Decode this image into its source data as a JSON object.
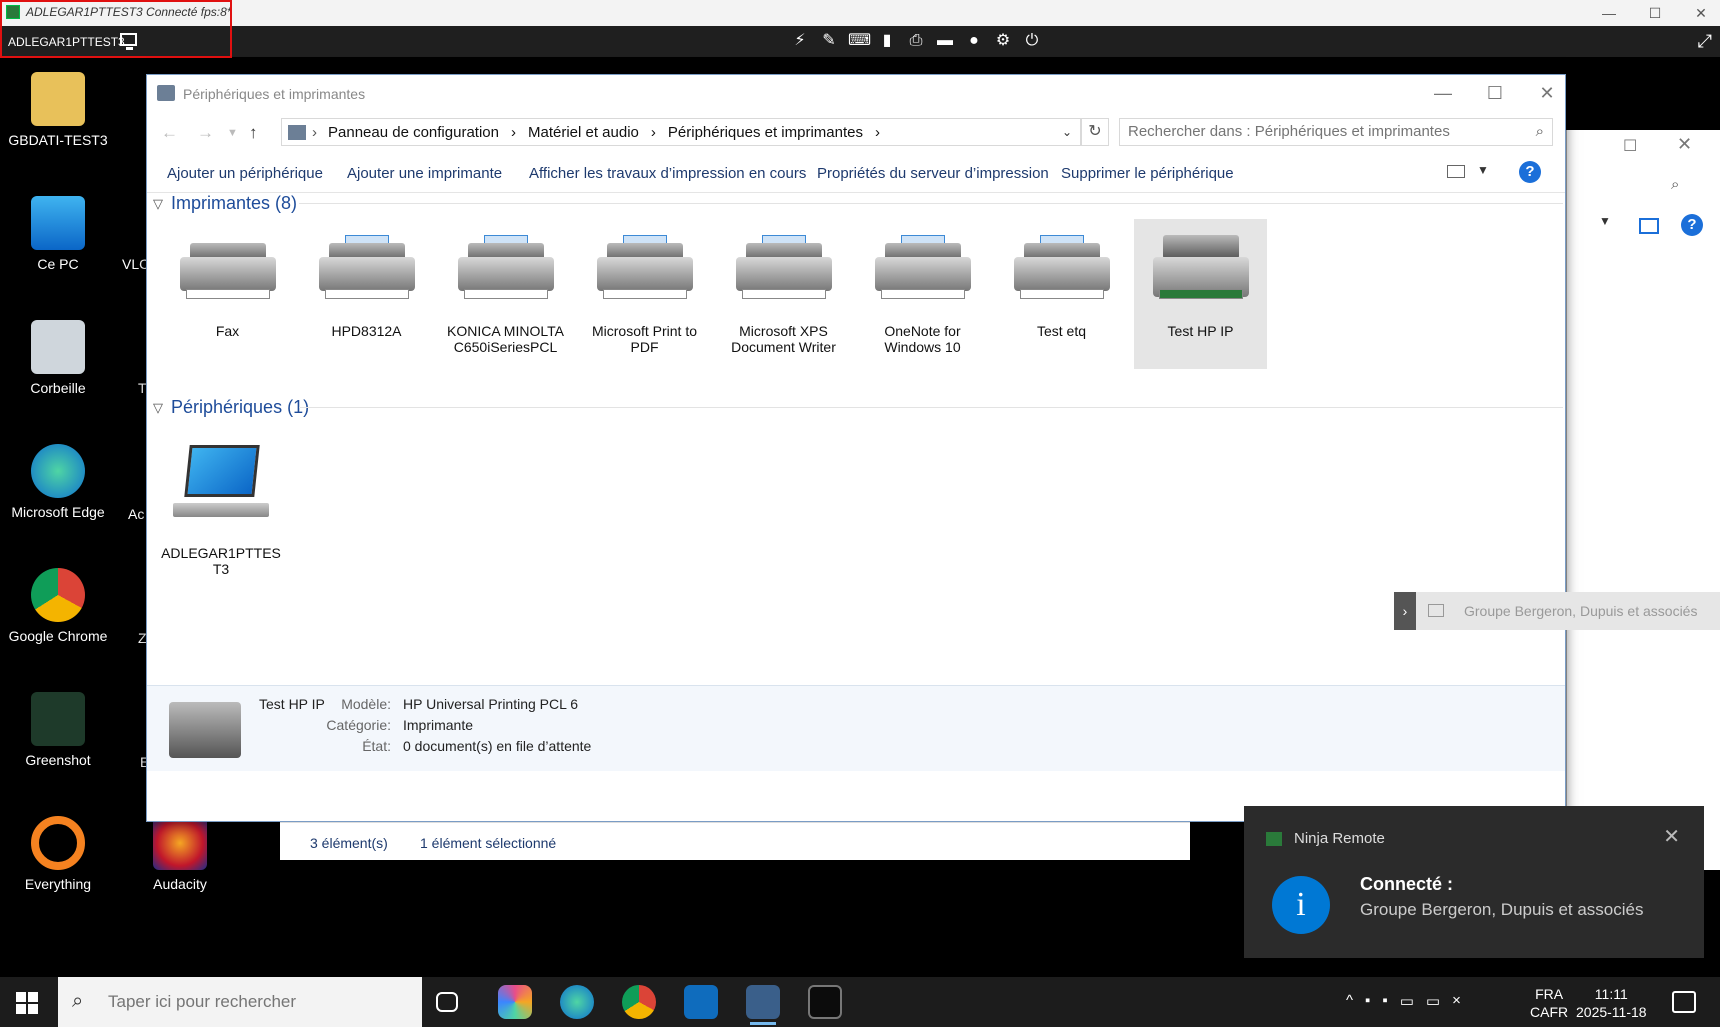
{
  "viewer": {
    "title": "ADLEGAR1PTTEST3 Connecté fps:8*",
    "hostname": "ADLEGAR1PTTEST3",
    "tools": [
      "flash-icon",
      "edit-icon",
      "keyboard-icon",
      "clipboard-icon",
      "printer-icon",
      "folder-icon",
      "chat-icon",
      "gear-icon",
      "power-icon"
    ]
  },
  "desktop": {
    "icons": [
      {
        "label": "GBDATI-TEST3"
      },
      {
        "label": "Ce PC"
      },
      {
        "label": "Corbeille"
      },
      {
        "label": "Microsoft Edge"
      },
      {
        "label": "Google Chrome"
      },
      {
        "label": "Greenshot"
      },
      {
        "label": "Everything"
      },
      {
        "label": "Audacity"
      }
    ],
    "partial_labels": [
      "VLC",
      "T",
      "Ac",
      "Z",
      "E"
    ]
  },
  "window": {
    "title": "Périphériques et imprimantes",
    "breadcrumb": [
      "Panneau de configuration",
      "Matériel et audio",
      "Périphériques et imprimantes"
    ],
    "search_placeholder": "Rechercher dans : Périphériques et imprimantes",
    "commands": [
      "Ajouter un périphérique",
      "Ajouter une imprimante",
      "Afficher les travaux d’impression en cours",
      "Propriétés du serveur d’impression",
      "Supprimer le périphérique"
    ],
    "help_label": "?",
    "printers_header": "Imprimantes (8)",
    "printers": [
      {
        "label": "Fax"
      },
      {
        "label": "HPD8312A"
      },
      {
        "label": "KONICA MINOLTA C650iSeriesPCL"
      },
      {
        "label": "Microsoft Print to PDF"
      },
      {
        "label": "Microsoft XPS Document Writer"
      },
      {
        "label": "OneNote for Windows 10"
      },
      {
        "label": "Test etq"
      },
      {
        "label": "Test HP IP"
      }
    ],
    "devices_header": "Périphériques (1)",
    "devices": [
      {
        "label": "ADLEGAR1PTTES T3"
      }
    ],
    "details": {
      "name": "Test HP IP",
      "model_label": "Modèle:",
      "model": "HP Universal Printing PCL 6",
      "category_label": "Catégorie:",
      "category": "Imprimante",
      "state_label": "État:",
      "state": "0 document(s) en file d’attente"
    },
    "status": {
      "count": "3 élément(s)",
      "selected": "1 élément sélectionné"
    }
  },
  "flyout": {
    "text": "Groupe Bergeron, Dupuis et associés"
  },
  "toast": {
    "app": "Ninja Remote",
    "heading": "Connecté :",
    "body": "Groupe Bergeron, Dupuis et associés"
  },
  "taskbar": {
    "search_placeholder": "Taper ici pour rechercher",
    "lang_line1": "FRA",
    "lang_line2": "CAFR",
    "time": "11:11",
    "date": "2025-11-18"
  }
}
